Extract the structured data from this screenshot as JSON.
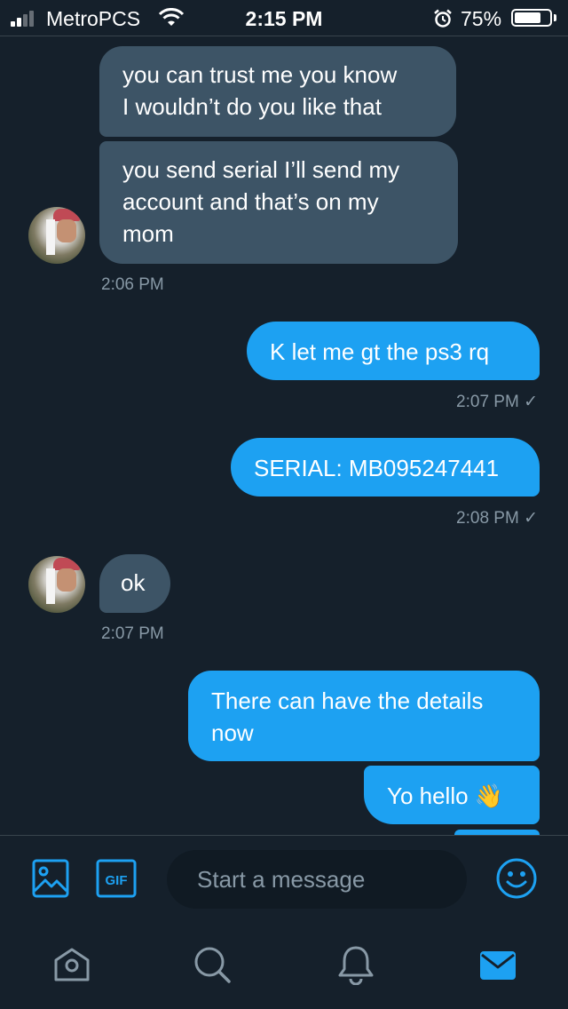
{
  "status_bar": {
    "carrier": "MetroPCS",
    "time": "2:15 PM",
    "battery_percent": "75%",
    "battery_level": 0.75,
    "signal_bars": 2,
    "icons": [
      "signal-icon",
      "wifi-icon",
      "alarm-icon",
      "battery-icon"
    ]
  },
  "conversation": {
    "messages": [
      {
        "direction": "received",
        "text_lines": [
          "you can trust me you know",
          "I wouldn’t do you like that"
        ]
      },
      {
        "direction": "received",
        "text_lines": [
          "you send serial I’ll send my",
          "account and that’s on my",
          "mom"
        ],
        "timestamp": "2:06 PM"
      },
      {
        "direction": "sent",
        "text": "K let me gt the ps3 rq",
        "timestamp": "2:07 PM ✓"
      },
      {
        "direction": "sent",
        "text": "SERIAL: MB095247441",
        "timestamp": "2:08 PM ✓"
      },
      {
        "direction": "received",
        "text": "ok",
        "timestamp": "2:07 PM"
      },
      {
        "direction": "sent",
        "text_lines": [
          "There can have the details",
          "now"
        ]
      },
      {
        "direction": "sent",
        "text": "Yo hello 👋"
      }
    ]
  },
  "composer": {
    "placeholder": "Start a message",
    "icons": [
      "image-icon",
      "gif-icon",
      "emoji-icon"
    ],
    "gif_label": "GIF"
  },
  "bottom_nav": {
    "items": [
      "home-icon",
      "search-icon",
      "notifications-icon",
      "messages-icon"
    ],
    "active": "messages-icon"
  },
  "colors": {
    "background": "#15202b",
    "received_bubble": "#3d5466",
    "sent_bubble": "#1da1f2",
    "accent": "#1da1f2",
    "timestamp": "#8899a6"
  }
}
